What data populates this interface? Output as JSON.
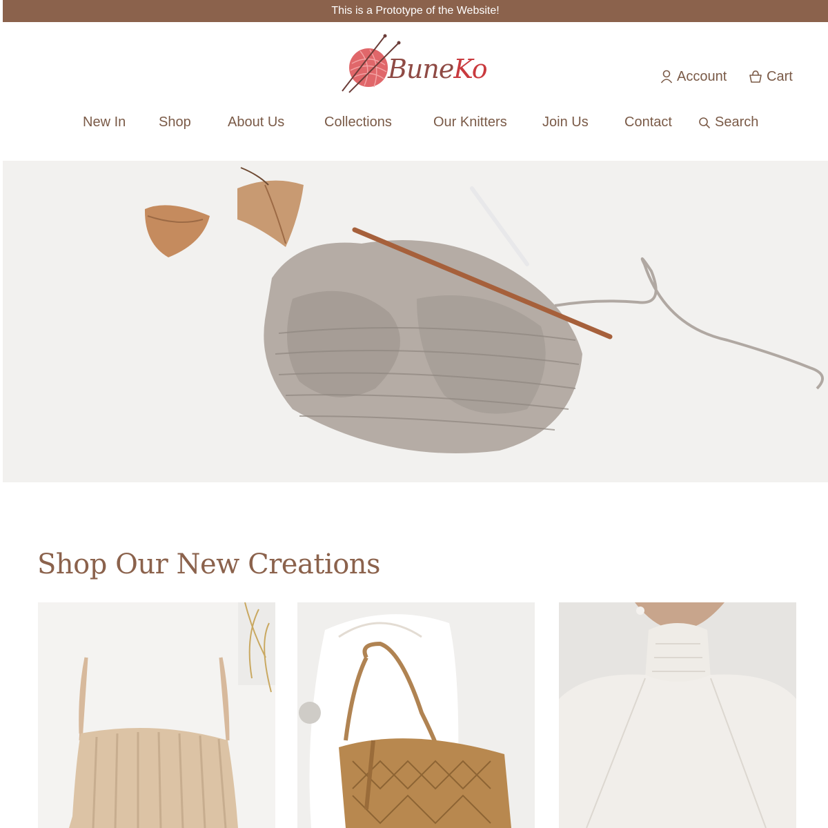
{
  "announcement": "This is a Prototype of the Website!",
  "brand": {
    "name_start": "Bune",
    "name_end": "Ko",
    "accent_color": "#c93a3e",
    "primary_color": "#8b624c"
  },
  "user_links": {
    "account_label": "Account",
    "account_icon": "user-icon",
    "cart_label": "Cart",
    "cart_icon": "basket-icon"
  },
  "nav": {
    "items": [
      {
        "label": "New In"
      },
      {
        "label": "Shop"
      },
      {
        "label": "About Us"
      },
      {
        "label": "Collections"
      },
      {
        "label": "Our Knitters"
      },
      {
        "label": "Join Us"
      },
      {
        "label": "Contact"
      }
    ],
    "search_label": "Search",
    "search_icon": "search-icon"
  },
  "hero": {
    "image": "knitted beanie with wooden needle and dried leaves"
  },
  "new_creations": {
    "title": "Shop Our New Creations",
    "products": [
      {
        "image": "beige cable-knit camisole"
      },
      {
        "image": "crochet macrame shoulder bag"
      },
      {
        "image": "cream raglan knit sweater"
      }
    ]
  }
}
